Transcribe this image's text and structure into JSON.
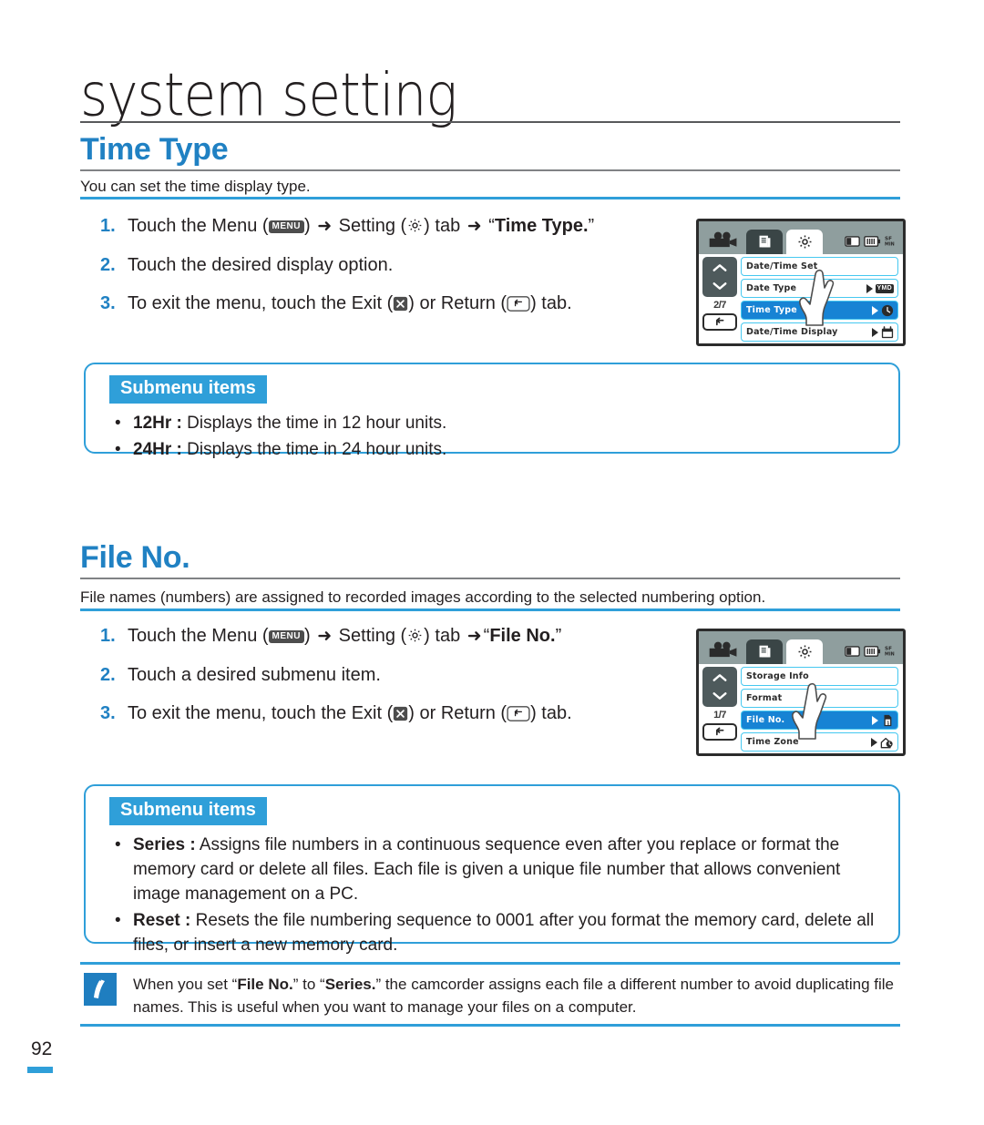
{
  "page": {
    "chapter_title": "system setting",
    "number": "92"
  },
  "sections": [
    {
      "heading": "Time Type",
      "description": "You can set the time display type.",
      "steps": [
        {
          "num": "1.",
          "pre": "Touch the Menu (",
          "menu_icon": "MENU",
          "mid1": ") ",
          "arrow1": "➜",
          "mid2": " Setting (",
          "gear_icon": "gear-icon",
          "mid3": ") tab ",
          "arrow2": "➜",
          "mid4": " “",
          "bold": "Time Type.",
          "post": "”"
        },
        {
          "num": "2.",
          "text": "Touch the desired display option."
        },
        {
          "num": "3.",
          "pre": "To exit the menu, touch the Exit (",
          "mid1": ") or Return (",
          "post": ") tab."
        }
      ],
      "submenu": {
        "tag": "Submenu items",
        "items": [
          {
            "term": "12Hr :",
            "desc": " Displays the time in 12 hour units."
          },
          {
            "term": "24Hr :",
            "desc": " Displays the time in 24 hour units."
          }
        ]
      }
    },
    {
      "heading": "File No.",
      "description": "File names (numbers) are assigned to recorded images according to the selected numbering option.",
      "steps": [
        {
          "num": "1.",
          "pre": "Touch the Menu (",
          "menu_icon": "MENU",
          "mid1": ") ",
          "arrow1": "➜",
          "mid2": " Setting (",
          "gear_icon": "gear-icon",
          "mid3": ") tab ",
          "arrow2": "➜",
          "mid4": "“",
          "bold": "File No.",
          "post": "”"
        },
        {
          "num": "2.",
          "text": "Touch a desired submenu item."
        },
        {
          "num": "3.",
          "pre": "To exit the menu, touch the Exit (",
          "mid1": ") or Return (",
          "post": ") tab."
        }
      ],
      "submenu": {
        "tag": "Submenu items",
        "items": [
          {
            "term": "Series :",
            "desc": " Assigns file numbers in a continuous sequence even after you replace or format the memory card or delete all files. Each file is given a unique file number that allows convenient image management on a PC."
          },
          {
            "term": "Reset :",
            "desc": " Resets the file numbering sequence to 0001 after you format the memory card, delete all files, or insert a new memory card."
          }
        ]
      }
    }
  ],
  "note": {
    "icon": "note-pencil-icon",
    "pre": "When you set “",
    "bold1": "File No.",
    "mid": "” to “",
    "bold2": "Series.",
    "post": "” the camcorder assigns each file a different number to avoid duplicating file names. This is useful when you want to manage your files on a computer."
  },
  "lcd_screens": [
    {
      "name": "time-type-menu",
      "page_indicator": "2/7",
      "status": {
        "card": "card-icon",
        "battery": "battery-icon",
        "quality": "SF\nMIN"
      },
      "rows": [
        {
          "label": "Date/Time Set",
          "selected": false,
          "has_arrow": false,
          "icon": ""
        },
        {
          "label": "Date Type",
          "selected": false,
          "has_arrow": true,
          "icon": "YMD"
        },
        {
          "label": "Time Type",
          "selected": true,
          "has_arrow": true,
          "icon": "clock-icon"
        },
        {
          "label": "Date/Time Display",
          "selected": false,
          "has_arrow": true,
          "icon": "calendar-icon"
        }
      ]
    },
    {
      "name": "file-no-menu",
      "page_indicator": "1/7",
      "status": {
        "card": "card-icon",
        "battery": "battery-icon",
        "quality": "SF\nMIN"
      },
      "rows": [
        {
          "label": "Storage Info",
          "selected": false,
          "has_arrow": false,
          "icon": ""
        },
        {
          "label": "Format",
          "selected": false,
          "has_arrow": false,
          "icon": ""
        },
        {
          "label": "File No.",
          "selected": true,
          "has_arrow": true,
          "icon": "file-icon"
        },
        {
          "label": "Time Zone",
          "selected": false,
          "has_arrow": true,
          "icon": "globe-home-icon"
        }
      ]
    }
  ],
  "colors": {
    "accent_blue": "#2081c3",
    "rule_blue": "#2f9fd9",
    "lcd_select": "#1783d4",
    "lcd_bezel": "#2b2b2b"
  }
}
